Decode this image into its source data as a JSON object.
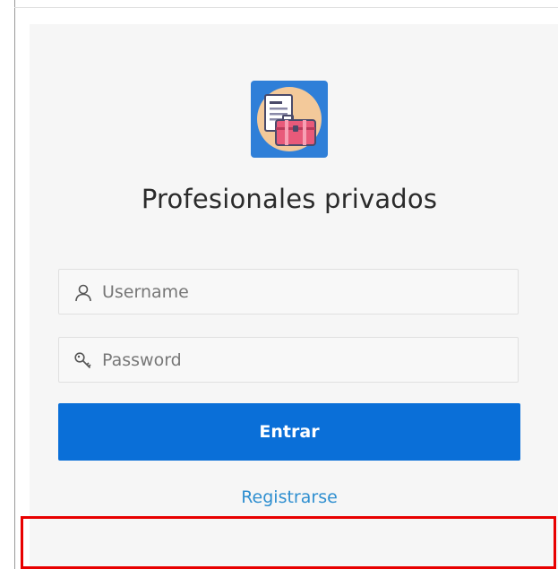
{
  "app": {
    "title": "Profesionales privados",
    "logo_icon": "documents-briefcase-icon"
  },
  "form": {
    "username_placeholder": "Username",
    "username_value": "",
    "password_placeholder": "Password",
    "password_value": "",
    "submit_label": "Entrar",
    "register_label": "Registrarse"
  },
  "colors": {
    "primary": "#0a6fd8",
    "link": "#2f8fd0",
    "highlight": "#e80000",
    "logo_bg": "#2f7fd8"
  }
}
